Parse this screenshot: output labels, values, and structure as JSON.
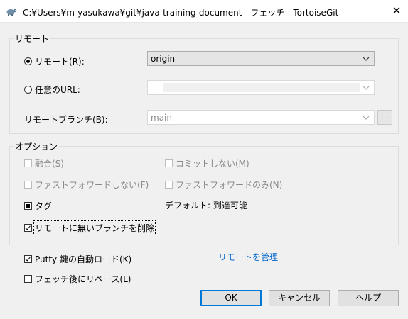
{
  "window": {
    "title": "C:¥Users¥m-yasukawa¥git¥java-training-document - フェッチ - TortoiseGit",
    "close_glyph": "✕"
  },
  "remote_group": {
    "label": "リモート",
    "remote_radio": {
      "label": "リモート(R):",
      "selected": true
    },
    "remote_combo": {
      "value": "origin"
    },
    "url_radio": {
      "label": "任意のURL:",
      "selected": false
    },
    "url_combo": {
      "value": ""
    },
    "branch_label": "リモートブランチ(B):",
    "branch_combo": {
      "value": "main"
    },
    "browse_button": "..."
  },
  "options_group": {
    "label": "オプション",
    "merge": {
      "label": "融合(S)",
      "checked": false,
      "enabled": false
    },
    "no_commit": {
      "label": "コミットしない(M)",
      "checked": false,
      "enabled": false
    },
    "no_ff": {
      "label": "ファストフォワードしない(F)",
      "checked": false,
      "enabled": false
    },
    "ff_only": {
      "label": "ファストフォワードのみ(N)",
      "checked": false,
      "enabled": false
    },
    "tags": {
      "label": "タグ",
      "state": "indeterminate"
    },
    "tags_default": "デフォルト: 到達可能",
    "prune": {
      "label": "リモートに無いブランチを削除",
      "checked": true
    }
  },
  "putty_key": {
    "label": "Putty 鍵の自動ロード(K)",
    "checked": true
  },
  "rebase_after": {
    "label": "フェッチ後にリベース(L)",
    "checked": false
  },
  "manage_remotes_link": "リモートを管理",
  "buttons": {
    "ok": "OK",
    "cancel": "キャンセル",
    "help": "ヘルプ"
  },
  "colors": {
    "link": "#0066cc",
    "default_button_border": "#0078d7",
    "window_bg": "#f0f0f0"
  }
}
